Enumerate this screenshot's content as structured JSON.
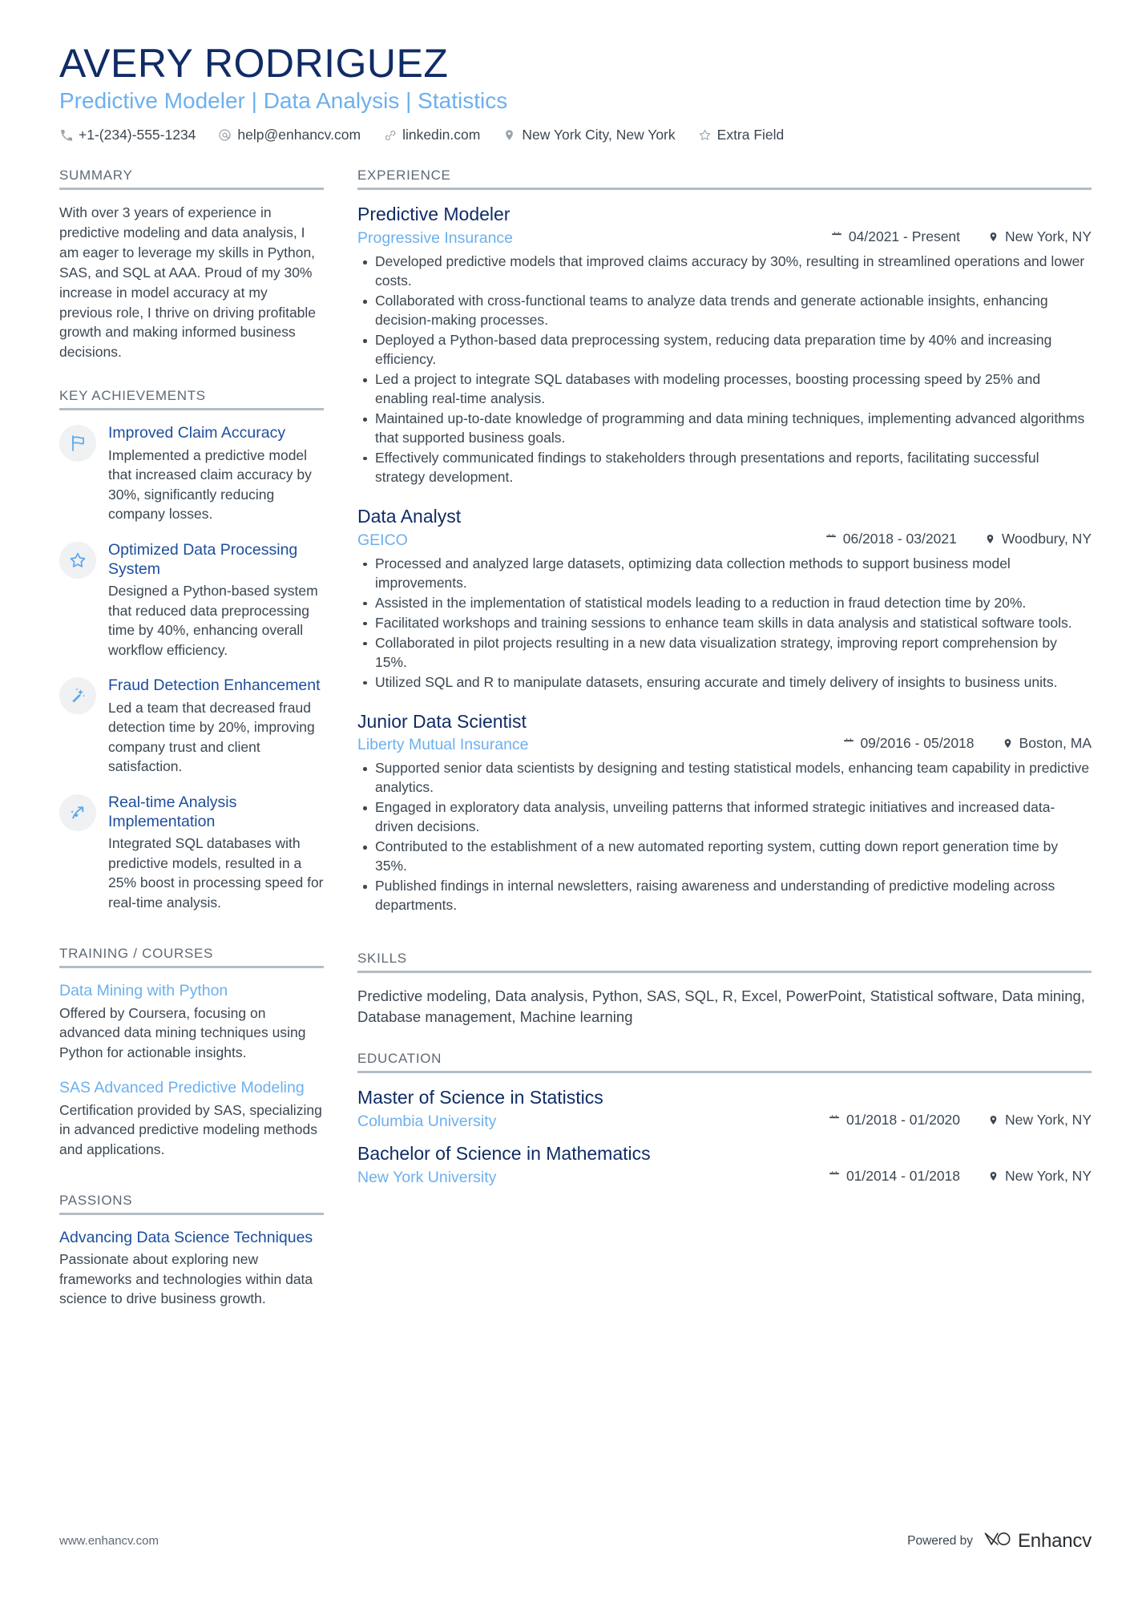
{
  "header": {
    "name": "AVERY RODRIGUEZ",
    "role": "Predictive Modeler | Data Analysis | Statistics",
    "contacts": [
      {
        "icon": "phone-icon",
        "text": "+1-(234)-555-1234"
      },
      {
        "icon": "email-icon",
        "text": "help@enhancv.com"
      },
      {
        "icon": "link-icon",
        "text": "linkedin.com"
      },
      {
        "icon": "location-icon",
        "text": "New York City, New York"
      },
      {
        "icon": "star-icon",
        "text": "Extra Field"
      }
    ]
  },
  "sidebar": {
    "summary": {
      "title": "SUMMARY",
      "text": "With over 3 years of experience in predictive modeling and data analysis, I am eager to leverage my skills in Python, SAS, and SQL at AAA. Proud of my 30% increase in model accuracy at my previous role, I thrive on driving profitable growth and making informed business decisions."
    },
    "key_achievements": {
      "title": "KEY ACHIEVEMENTS",
      "items": [
        {
          "icon": "flag-icon",
          "title": "Improved Claim Accuracy",
          "desc": "Implemented a predictive model that increased claim accuracy by 30%, significantly reducing company losses."
        },
        {
          "icon": "star-outline-icon",
          "title": "Optimized Data Processing System",
          "desc": "Designed a Python-based system that reduced data preprocessing time by 40%, enhancing overall workflow efficiency."
        },
        {
          "icon": "magic-wand-icon",
          "title": "Fraud Detection Enhancement",
          "desc": "Led a team that decreased fraud detection time by 20%, improving company trust and client satisfaction."
        },
        {
          "icon": "trend-arrow-icon",
          "title": "Real-time Analysis Implementation",
          "desc": "Integrated SQL databases with predictive models, resulted in a 25% boost in processing speed for real-time analysis."
        }
      ]
    },
    "training": {
      "title": "TRAINING / COURSES",
      "items": [
        {
          "title": "Data Mining with Python",
          "desc": "Offered by Coursera, focusing on advanced data mining techniques using Python for actionable insights."
        },
        {
          "title": "SAS Advanced Predictive Modeling",
          "desc": "Certification provided by SAS, specializing in advanced predictive modeling methods and applications."
        }
      ]
    },
    "passions": {
      "title": "PASSIONS",
      "items": [
        {
          "title": "Advancing Data Science Techniques",
          "desc": "Passionate about exploring new frameworks and technologies within data science to drive business growth."
        }
      ]
    }
  },
  "main": {
    "experience": {
      "title": "EXPERIENCE",
      "jobs": [
        {
          "role": "Predictive Modeler",
          "company": "Progressive Insurance",
          "dates": "04/2021 - Present",
          "location": "New York, NY",
          "bullets": [
            "Developed predictive models that improved claims accuracy by 30%, resulting in streamlined operations and lower costs.",
            "Collaborated with cross-functional teams to analyze data trends and generate actionable insights, enhancing decision-making processes.",
            "Deployed a Python-based data preprocessing system, reducing data preparation time by 40% and increasing efficiency.",
            "Led a project to integrate SQL databases with modeling processes, boosting processing speed by 25% and enabling real-time analysis.",
            "Maintained up-to-date knowledge of programming and data mining techniques, implementing advanced algorithms that supported business goals.",
            "Effectively communicated findings to stakeholders through presentations and reports, facilitating successful strategy development."
          ]
        },
        {
          "role": "Data Analyst",
          "company": "GEICO",
          "dates": "06/2018 - 03/2021",
          "location": "Woodbury, NY",
          "bullets": [
            "Processed and analyzed large datasets, optimizing data collection methods to support business model improvements.",
            "Assisted in the implementation of statistical models leading to a reduction in fraud detection time by 20%.",
            "Facilitated workshops and training sessions to enhance team skills in data analysis and statistical software tools.",
            "Collaborated in pilot projects resulting in a new data visualization strategy, improving report comprehension by 15%.",
            "Utilized SQL and R to manipulate datasets, ensuring accurate and timely delivery of insights to business units."
          ]
        },
        {
          "role": "Junior Data Scientist",
          "company": "Liberty Mutual Insurance",
          "dates": "09/2016 - 05/2018",
          "location": "Boston, MA",
          "bullets": [
            "Supported senior data scientists by designing and testing statistical models, enhancing team capability in predictive analytics.",
            "Engaged in exploratory data analysis, unveiling patterns that informed strategic initiatives and increased data-driven decisions.",
            "Contributed to the establishment of a new automated reporting system, cutting down report generation time by 35%.",
            "Published findings in internal newsletters, raising awareness and understanding of predictive modeling across departments."
          ]
        }
      ]
    },
    "skills": {
      "title": "SKILLS",
      "text": "Predictive modeling, Data analysis, Python, SAS, SQL, R, Excel, PowerPoint, Statistical software, Data mining, Database management, Machine learning"
    },
    "education": {
      "title": "EDUCATION",
      "items": [
        {
          "degree": "Master of Science in Statistics",
          "school": "Columbia University",
          "dates": "01/2018 - 01/2020",
          "location": "New York, NY"
        },
        {
          "degree": "Bachelor of Science in Mathematics",
          "school": "New York University",
          "dates": "01/2014 - 01/2018",
          "location": "New York, NY"
        }
      ]
    }
  },
  "footer": {
    "url": "www.enhancv.com",
    "powered_by": "Powered by",
    "brand": "Enhancv"
  },
  "colors": {
    "name_navy": "#102c66",
    "accent_light_blue": "#6cb0ee",
    "accent_mid_blue": "#1c4e9c",
    "body_text": "#3c4752",
    "rule": "#b4bcc4",
    "badge_bg": "#f0f1f2"
  }
}
